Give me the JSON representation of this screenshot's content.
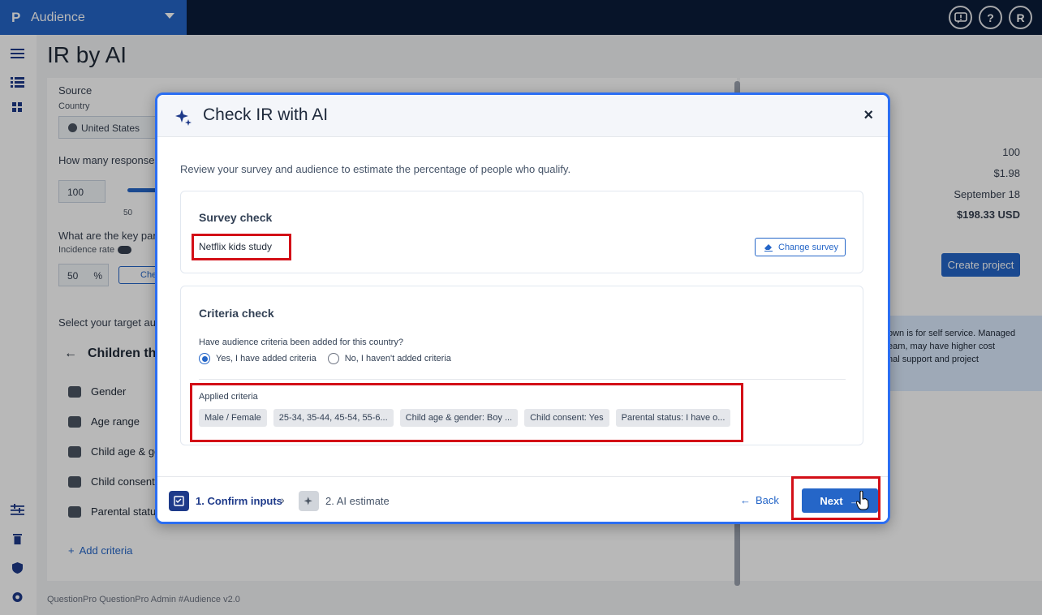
{
  "topbar": {
    "brand_logo": "P",
    "product": "Audience",
    "icons": [
      "feedback-icon",
      "help-icon",
      "user-avatar"
    ],
    "avatar_initial": "R",
    "help_glyph": "?",
    "feedback_glyph": "!"
  },
  "page": {
    "title": "IR by AI",
    "source_label": "Source",
    "country_label": "Country",
    "country_value": "United States",
    "responses_label": "How many responses",
    "responses_value": "100",
    "slider_min": "50",
    "key_params_label": "What are the key par",
    "incidence_label": "Incidence rate",
    "incidence_value": "50",
    "incidence_unit": "%",
    "check_btn": "Che",
    "target_label": "Select your target au",
    "children_heading": "Children th",
    "criteria": [
      "Gender",
      "Age range",
      "Child age & ge",
      "Child consent",
      "Parental statu"
    ],
    "add_criteria": "Add criteria",
    "footer": "QuestionPro QuestionPro Admin  #Audience v2.0"
  },
  "summary": {
    "responses": "100",
    "cpi": "$1.98",
    "date": "September 18",
    "total": "$198.33 USD",
    "create_btn": "Create project",
    "info_lines": [
      "own is for self service. Managed",
      "eam, may have higher cost",
      "nal support and project"
    ]
  },
  "modal": {
    "title": "Check IR with AI",
    "close": "×",
    "description": "Review your survey and audience to estimate the percentage of people who qualify.",
    "survey_check": {
      "title": "Survey check",
      "survey_name": "Netflix kids study",
      "change_btn": "Change survey"
    },
    "criteria_check": {
      "title": "Criteria check",
      "question": "Have audience criteria been added for this country?",
      "options": [
        "Yes, I have added criteria",
        "No, I haven't added criteria"
      ],
      "selected": 0,
      "applied_label": "Applied criteria",
      "chips": [
        "Male / Female",
        "25-34, 35-44, 45-54, 55-6...",
        "Child age & gender: Boy ...",
        "Child consent: Yes",
        "Parental status: I have o..."
      ]
    },
    "steps": [
      {
        "label": "1. Confirm inputs",
        "active": true
      },
      {
        "label": "2. AI estimate",
        "active": false
      }
    ],
    "back_btn": "Back",
    "next_btn": "Next",
    "colors": {
      "accent": "#2566c8",
      "highlight": "#d30f17",
      "modal_border": "#2b6ef2"
    }
  }
}
